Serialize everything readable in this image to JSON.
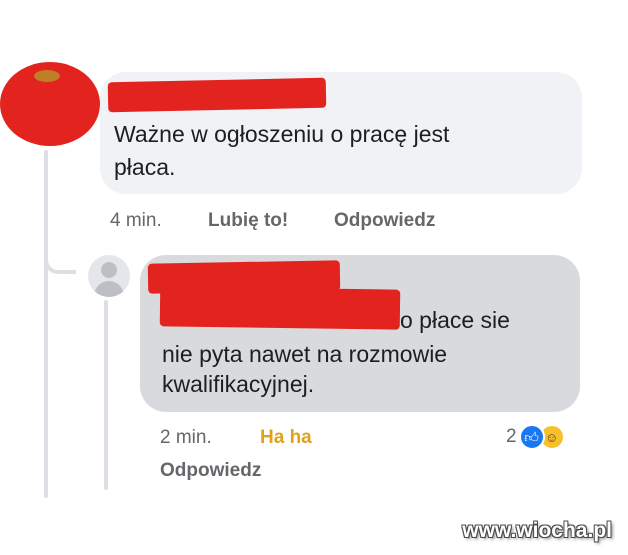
{
  "main_comment": {
    "text_lines": [
      "Ważne w ogłoszeniu o pracę jest",
      "płaca."
    ],
    "time": "4 min.",
    "like_label": "Lubię to!",
    "reply_label": "Odpowiedz"
  },
  "reply_comment": {
    "text_lines": [
      "o płace sie",
      "nie pyta nawet na rozmowie",
      "kwalifikacyjnej."
    ],
    "time": "2 min.",
    "reaction_label": "Ha ha",
    "reply_label": "Odpowiedz",
    "reactions": {
      "count": "2",
      "icons": [
        "like-icon",
        "haha-icon"
      ]
    }
  },
  "watermark": "www.wiocha.pl",
  "colors": {
    "redaction": "#e3231e",
    "bubble_main": "#f0f2f5",
    "bubble_reply": "#d8dade",
    "haha_active": "#e0a21a",
    "like_blue": "#1877f2"
  }
}
